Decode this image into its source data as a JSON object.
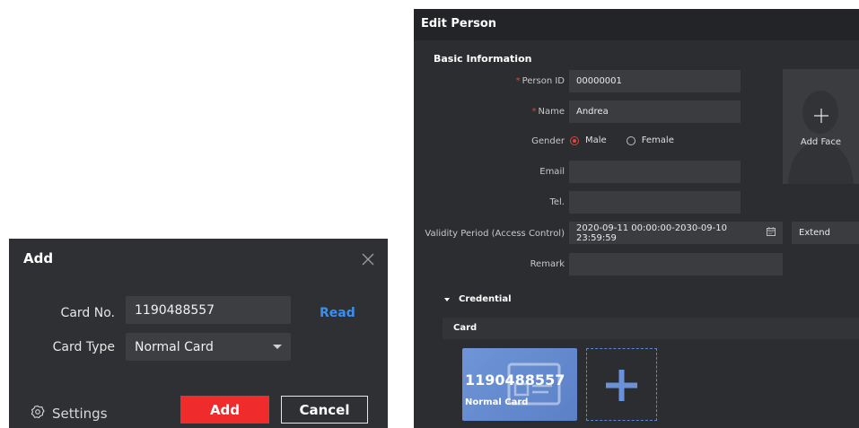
{
  "add_dialog": {
    "title": "Add",
    "card_no_label": "Card No.",
    "card_no_value": "1190488557",
    "read_label": "Read",
    "card_type_label": "Card Type",
    "card_type_value": "Normal Card",
    "settings_label": "Settings",
    "add_button": "Add",
    "cancel_button": "Cancel",
    "icons": {
      "close": "close-icon",
      "settings": "gear-icon",
      "dropdown": "chevron-down-icon"
    }
  },
  "edit_person": {
    "title": "Edit Person",
    "basic_info_title": "Basic Information",
    "required_mark": "*",
    "person_id_label": "Person ID",
    "person_id_value": "00000001",
    "name_label": "Name",
    "name_value": "Andrea",
    "gender_label": "Gender",
    "gender_options": [
      "Male",
      "Female"
    ],
    "gender_selected": "Male",
    "email_label": "Email",
    "email_value": "",
    "tel_label": "Tel.",
    "tel_value": "",
    "validity_label": "Validity Period (Access Control)",
    "validity_value": "2020-09-11 00:00:00-2030-09-10 23:59:59",
    "extend_value": "Extend",
    "remark_label": "Remark",
    "remark_value": "",
    "add_face_label": "Add Face",
    "credential_title": "Credential",
    "card_section_title": "Card",
    "card": {
      "number": "1190488557",
      "type": "Normal Card"
    },
    "colors": {
      "required": "#e0433d",
      "card_tile": "#6a90d6",
      "accent_red": "#ef2b2b",
      "link_blue": "#3b8ff0"
    },
    "icons": {
      "face": "person-silhouette-icon",
      "add": "plus-icon",
      "calendar": "calendar-icon"
    }
  }
}
